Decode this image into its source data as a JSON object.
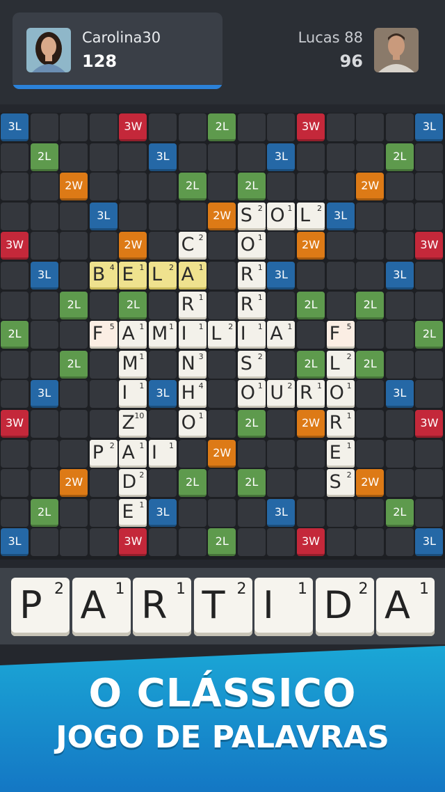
{
  "players": {
    "player1": {
      "name": "Carolina30",
      "score": "128"
    },
    "player2": {
      "name": "Lucas 88",
      "score": "96"
    }
  },
  "colors": {
    "3L": "#2568a6",
    "2L": "#5e9a4d",
    "2W": "#dd7a16",
    "3W": "#c4283a",
    "empty": "#34373d",
    "active_bar": "#2b82d9"
  },
  "board": {
    "size": 15,
    "premium_squares": [
      [
        0,
        0,
        "3L"
      ],
      [
        0,
        4,
        "3W"
      ],
      [
        0,
        7,
        "2L"
      ],
      [
        0,
        10,
        "3W"
      ],
      [
        0,
        14,
        "3L"
      ],
      [
        1,
        1,
        "2L"
      ],
      [
        1,
        5,
        "3L"
      ],
      [
        1,
        9,
        "3L"
      ],
      [
        1,
        13,
        "2L"
      ],
      [
        2,
        2,
        "2W"
      ],
      [
        2,
        6,
        "2L"
      ],
      [
        2,
        8,
        "2L"
      ],
      [
        2,
        12,
        "2W"
      ],
      [
        3,
        3,
        "3L"
      ],
      [
        3,
        7,
        "2W"
      ],
      [
        3,
        11,
        "3L"
      ],
      [
        4,
        0,
        "3W"
      ],
      [
        4,
        4,
        "2W"
      ],
      [
        4,
        10,
        "2W"
      ],
      [
        4,
        14,
        "3W"
      ],
      [
        5,
        1,
        "3L"
      ],
      [
        5,
        9,
        "3L"
      ],
      [
        5,
        13,
        "3L"
      ],
      [
        6,
        2,
        "2L"
      ],
      [
        6,
        4,
        "2L"
      ],
      [
        6,
        10,
        "2L"
      ],
      [
        6,
        12,
        "2L"
      ],
      [
        7,
        0,
        "2L"
      ],
      [
        7,
        14,
        "2L"
      ],
      [
        8,
        2,
        "2L"
      ],
      [
        8,
        10,
        "2L"
      ],
      [
        8,
        12,
        "2L"
      ],
      [
        9,
        1,
        "3L"
      ],
      [
        9,
        5,
        "3L"
      ],
      [
        9,
        13,
        "3L"
      ],
      [
        10,
        0,
        "3W"
      ],
      [
        10,
        8,
        "2L"
      ],
      [
        10,
        10,
        "2W"
      ],
      [
        10,
        14,
        "3W"
      ],
      [
        11,
        7,
        "2W"
      ],
      [
        12,
        2,
        "2W"
      ],
      [
        12,
        6,
        "2L"
      ],
      [
        12,
        8,
        "2L"
      ],
      [
        12,
        12,
        "2W"
      ],
      [
        13,
        1,
        "2L"
      ],
      [
        13,
        5,
        "3L"
      ],
      [
        13,
        9,
        "3L"
      ],
      [
        13,
        13,
        "2L"
      ],
      [
        14,
        0,
        "3L"
      ],
      [
        14,
        4,
        "3W"
      ],
      [
        14,
        7,
        "2L"
      ],
      [
        14,
        10,
        "3W"
      ],
      [
        14,
        14,
        "3L"
      ]
    ],
    "tiles": [
      [
        3,
        8,
        "S",
        "2",
        ""
      ],
      [
        3,
        9,
        "O",
        "1",
        ""
      ],
      [
        3,
        10,
        "L",
        "2",
        ""
      ],
      [
        4,
        6,
        "C",
        "2",
        ""
      ],
      [
        4,
        8,
        "O",
        "1",
        ""
      ],
      [
        5,
        3,
        "B",
        "4",
        "hl"
      ],
      [
        5,
        4,
        "E",
        "1",
        "hl"
      ],
      [
        5,
        5,
        "L",
        "2",
        "hl"
      ],
      [
        5,
        6,
        "A",
        "1",
        "hl"
      ],
      [
        5,
        8,
        "R",
        "1",
        ""
      ],
      [
        6,
        6,
        "R",
        "1",
        ""
      ],
      [
        6,
        8,
        "R",
        "1",
        ""
      ],
      [
        7,
        3,
        "F",
        "5",
        "sel"
      ],
      [
        7,
        4,
        "A",
        "1",
        ""
      ],
      [
        7,
        5,
        "M",
        "1",
        ""
      ],
      [
        7,
        6,
        "I",
        "1",
        ""
      ],
      [
        7,
        7,
        "L",
        "2",
        ""
      ],
      [
        7,
        8,
        "I",
        "1",
        ""
      ],
      [
        7,
        9,
        "A",
        "1",
        ""
      ],
      [
        7,
        11,
        "F",
        "5",
        "sel"
      ],
      [
        8,
        4,
        "M",
        "1",
        ""
      ],
      [
        8,
        6,
        "N",
        "3",
        ""
      ],
      [
        8,
        8,
        "S",
        "2",
        ""
      ],
      [
        8,
        11,
        "L",
        "2",
        ""
      ],
      [
        9,
        4,
        "I",
        "1",
        ""
      ],
      [
        9,
        6,
        "H",
        "4",
        ""
      ],
      [
        9,
        8,
        "O",
        "1",
        ""
      ],
      [
        9,
        9,
        "U",
        "2",
        ""
      ],
      [
        9,
        10,
        "R",
        "1",
        ""
      ],
      [
        9,
        11,
        "O",
        "1",
        ""
      ],
      [
        10,
        4,
        "Z",
        "10",
        ""
      ],
      [
        10,
        6,
        "O",
        "1",
        ""
      ],
      [
        10,
        11,
        "R",
        "1",
        ""
      ],
      [
        11,
        3,
        "P",
        "2",
        ""
      ],
      [
        11,
        4,
        "A",
        "1",
        ""
      ],
      [
        11,
        5,
        "I",
        "1",
        ""
      ],
      [
        11,
        11,
        "E",
        "1",
        ""
      ],
      [
        12,
        4,
        "D",
        "2",
        ""
      ],
      [
        12,
        11,
        "S",
        "2",
        ""
      ],
      [
        13,
        4,
        "E",
        "1",
        ""
      ]
    ]
  },
  "rack": [
    {
      "letter": "P",
      "points": "2"
    },
    {
      "letter": "A",
      "points": "1"
    },
    {
      "letter": "R",
      "points": "1"
    },
    {
      "letter": "T",
      "points": "2"
    },
    {
      "letter": "I",
      "points": "1"
    },
    {
      "letter": "D",
      "points": "2"
    },
    {
      "letter": "A",
      "points": "1"
    }
  ],
  "banner": {
    "line1": "O CLÁSSICO",
    "line2": "JOGO DE PALAVRAS"
  }
}
